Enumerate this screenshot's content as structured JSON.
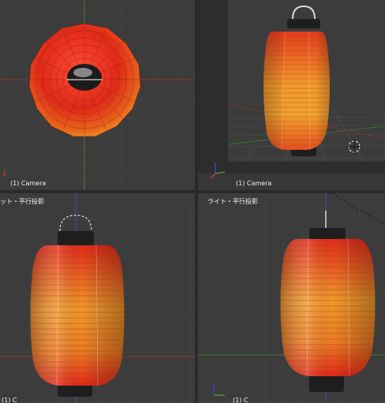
{
  "viewports": {
    "top_left": {
      "label": "(1) Camera"
    },
    "top_right": {
      "label": "(1) Camera"
    },
    "bottom_left": {
      "header": "ット・平行投影",
      "footer": "(1) C"
    },
    "bottom_right": {
      "header": "ライト・平行投影",
      "footer": "(1) C"
    }
  },
  "colors": {
    "viewport_bg": "#3c3c3c",
    "separator": "#2a2a2a",
    "x_axis": "#c43b3b",
    "y_axis": "#4f9e2e",
    "z_axis": "#3a4fd0",
    "lantern_red": "#d8301a",
    "lantern_orange": "#f09a2a",
    "lantern_cap": "#1e1e1e"
  },
  "icons": {
    "axis_gizmo": "axis-gizmo-icon",
    "light_cursor": "3d-cursor-icon"
  }
}
